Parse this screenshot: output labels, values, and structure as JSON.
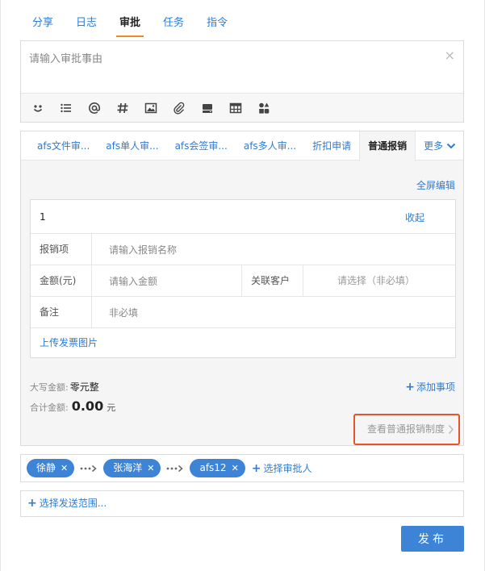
{
  "top_tabs": [
    {
      "label": "分享",
      "active": false
    },
    {
      "label": "日志",
      "active": false
    },
    {
      "label": "审批",
      "active": true
    },
    {
      "label": "任务",
      "active": false
    },
    {
      "label": "指令",
      "active": false
    }
  ],
  "composer": {
    "placeholder": "请输入审批事由",
    "close": "×",
    "toolbar_icons": [
      "emoji-icon",
      "list-icon",
      "at-icon",
      "hashtag-icon",
      "image-icon",
      "attachment-icon",
      "storage-icon",
      "table-icon",
      "apps-icon"
    ]
  },
  "approval_tabs": [
    {
      "label": "afs文件审...",
      "active": false
    },
    {
      "label": "afs单人审...",
      "active": false
    },
    {
      "label": "afs会签审...",
      "active": false
    },
    {
      "label": "afs多人审...",
      "active": false
    },
    {
      "label": "折扣申请",
      "active": false
    },
    {
      "label": "普通报销",
      "active": true
    },
    {
      "label": "更多",
      "active": false
    }
  ],
  "form": {
    "fullscreen_label": "全屏编辑",
    "item_index": "1",
    "collapse_label": "收起",
    "expense_item_label": "报销项",
    "expense_item_placeholder": "请输入报销名称",
    "amount_label": "金额(元)",
    "amount_placeholder": "请输入金额",
    "customer_label": "关联客户",
    "customer_placeholder": "请选择（非必填）",
    "note_label": "备注",
    "note_placeholder": "非必填",
    "upload_label": "上传发票图片"
  },
  "summary": {
    "uppercase_label": "大写金额:",
    "uppercase_value": "零元整",
    "total_label": "合计金额:",
    "total_value": "0.00",
    "total_unit": "元",
    "add_item_label": "添加事项"
  },
  "policy_link": "查看普通报销制度",
  "approvers": {
    "people": [
      "徐静",
      "张海洋",
      "afs12"
    ],
    "select_label": "选择审批人"
  },
  "scope_label": "选择发送范围...",
  "publish_label": "发布",
  "colors": {
    "accent": "#3d84d6",
    "link": "#2d7bd4",
    "tab_underline": "#f08a1c",
    "highlight_border": "#e5542d"
  }
}
